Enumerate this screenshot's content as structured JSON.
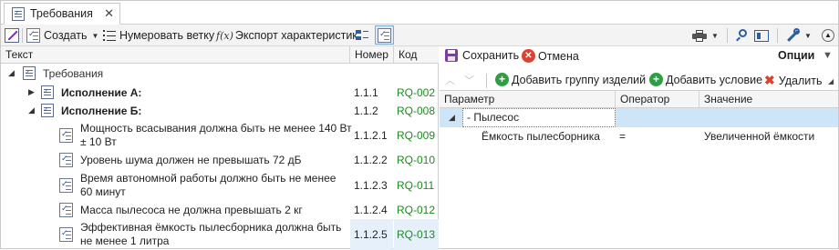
{
  "tab": {
    "title": "Требования",
    "close": "✕",
    "icon": "requirements-icon"
  },
  "toolbar": {
    "create_label": "Создать",
    "numerate_label": "Нумеровать ветку",
    "export_label": "Экспорт характеристик",
    "export_glyph": "f(x)"
  },
  "left_grid": {
    "columns": [
      "Текст",
      "Номер",
      "Код"
    ],
    "root": {
      "label": "Требования"
    },
    "rows": [
      {
        "text": "Исполнение А:",
        "number": "1.1.1",
        "code": "RQ-002"
      },
      {
        "text": "Исполнение Б:",
        "number": "1.1.2",
        "code": "RQ-008"
      },
      {
        "text_line1": "Мощность всасывания должна быть не менее 140 Вт",
        "text_line2": "± 10 Вт",
        "number": "1.1.2.1",
        "code": "RQ-009"
      },
      {
        "text": "Уровень шума должен не превышать 72 дБ",
        "number": "1.1.2.2",
        "code": "RQ-010"
      },
      {
        "text_line1": "Время автономной работы должно быть не менее",
        "text_line2": "60 минут",
        "number": "1.1.2.3",
        "code": "RQ-011"
      },
      {
        "text": "Масса пылесоса не должна превышать 2 кг",
        "number": "1.1.2.4",
        "code": "RQ-012"
      },
      {
        "text_line1": "Эффективная ёмкость пылесборника должна быть",
        "text_line2": "не менее 1 литра",
        "number": "1.1.2.5",
        "code": "RQ-013"
      }
    ]
  },
  "right_panel": {
    "save_label": "Сохранить",
    "cancel_label": "Отмена",
    "options_label": "Опции",
    "add_group_label": "Добавить группу изделий",
    "add_condition_label": "Добавить условие",
    "delete_label": "Удалить",
    "columns": [
      "Параметр",
      "Оператор",
      "Значение"
    ],
    "group": {
      "label": "- Пылесос"
    },
    "condition": {
      "parameter": "Ёмкость пылесборника",
      "operator": "=",
      "value": "Увеличенной ёмкости"
    }
  },
  "colors": {
    "code_green": "#1d8a1d",
    "selection": "#cde5f7",
    "cancel_red": "#d9432f",
    "add_green": "#2e9e44"
  }
}
